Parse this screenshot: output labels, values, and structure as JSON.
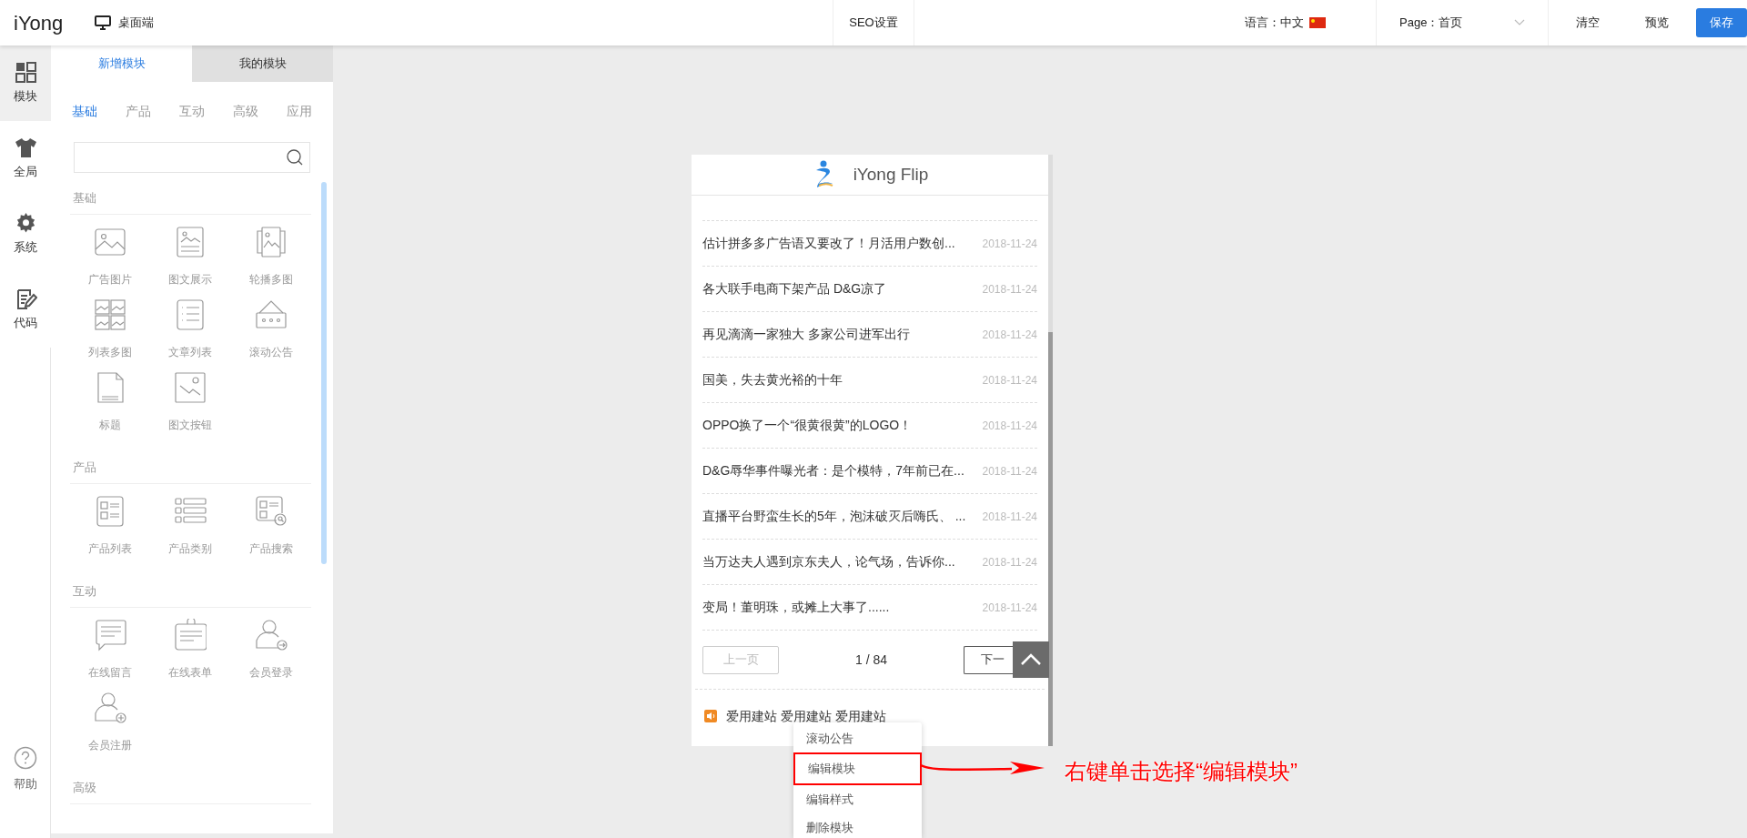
{
  "topbar": {
    "logo": "iYong",
    "device": "桌面端",
    "seo": "SEO设置",
    "language": "语言：中文",
    "page": "Page：首页",
    "clear": "清空",
    "preview": "预览",
    "save": "保存"
  },
  "rail": [
    {
      "label": "模块",
      "selected": true
    },
    {
      "label": "全局",
      "selected": false
    },
    {
      "label": "系统",
      "selected": false
    },
    {
      "label": "代码",
      "selected": false
    }
  ],
  "help": "帮助",
  "panel_tabs": [
    {
      "label": "新增模块",
      "selected": true
    },
    {
      "label": "我的模块",
      "selected": false
    }
  ],
  "categories": [
    {
      "label": "基础",
      "selected": true
    },
    {
      "label": "产品",
      "selected": false
    },
    {
      "label": "互动",
      "selected": false
    },
    {
      "label": "高级",
      "selected": false
    },
    {
      "label": "应用",
      "selected": false
    }
  ],
  "sections": [
    {
      "title": "基础",
      "items": [
        "广告图片",
        "图文展示",
        "轮播多图",
        "列表多图",
        "文章列表",
        "滚动公告",
        "标题",
        "图文按钮"
      ]
    },
    {
      "title": "产品",
      "items": [
        "产品列表",
        "产品类别",
        "产品搜索"
      ]
    },
    {
      "title": "互动",
      "items": [
        "在线留言",
        "在线表单",
        "会员登录",
        "会员注册"
      ]
    },
    {
      "title": "高级"
    }
  ],
  "preview": {
    "site_title": "iYong Flip",
    "news": [
      {
        "title": "估计拼多多广告语又要改了！月活用户数创...",
        "date": "2018-11-24"
      },
      {
        "title": "各大联手电商下架产品 D&G凉了",
        "date": "2018-11-24"
      },
      {
        "title": "再见滴滴一家独大 多家公司进军出行",
        "date": "2018-11-24"
      },
      {
        "title": "国美，失去黄光裕的十年",
        "date": "2018-11-24"
      },
      {
        "title": "OPPO换了一个“很黄很黄”的LOGO！",
        "date": "2018-11-24"
      },
      {
        "title": "D&G辱华事件曝光者：是个模特，7年前已在...",
        "date": "2018-11-24"
      },
      {
        "title": "直播平台野蛮生长的5年，泡沫破灭后嗨氏、 ...",
        "date": "2018-11-24"
      },
      {
        "title": "当万达夫人遇到京东夫人，论气场，告诉你...",
        "date": "2018-11-24"
      },
      {
        "title": "变局！董明珠，或摊上大事了......",
        "date": "2018-11-24"
      }
    ],
    "pager": {
      "prev": "上一页",
      "page": "1 / 84",
      "next": "下一"
    },
    "notice": "爱用建站 爱用建站 爱用建站"
  },
  "context_menu": [
    {
      "label": "滚动公告",
      "highlighted": false
    },
    {
      "label": "编辑模块",
      "highlighted": true
    },
    {
      "label": "编辑样式",
      "highlighted": false
    },
    {
      "label": "删除模块",
      "highlighted": false
    }
  ],
  "annotation": "右键单击选择“编辑模块”"
}
